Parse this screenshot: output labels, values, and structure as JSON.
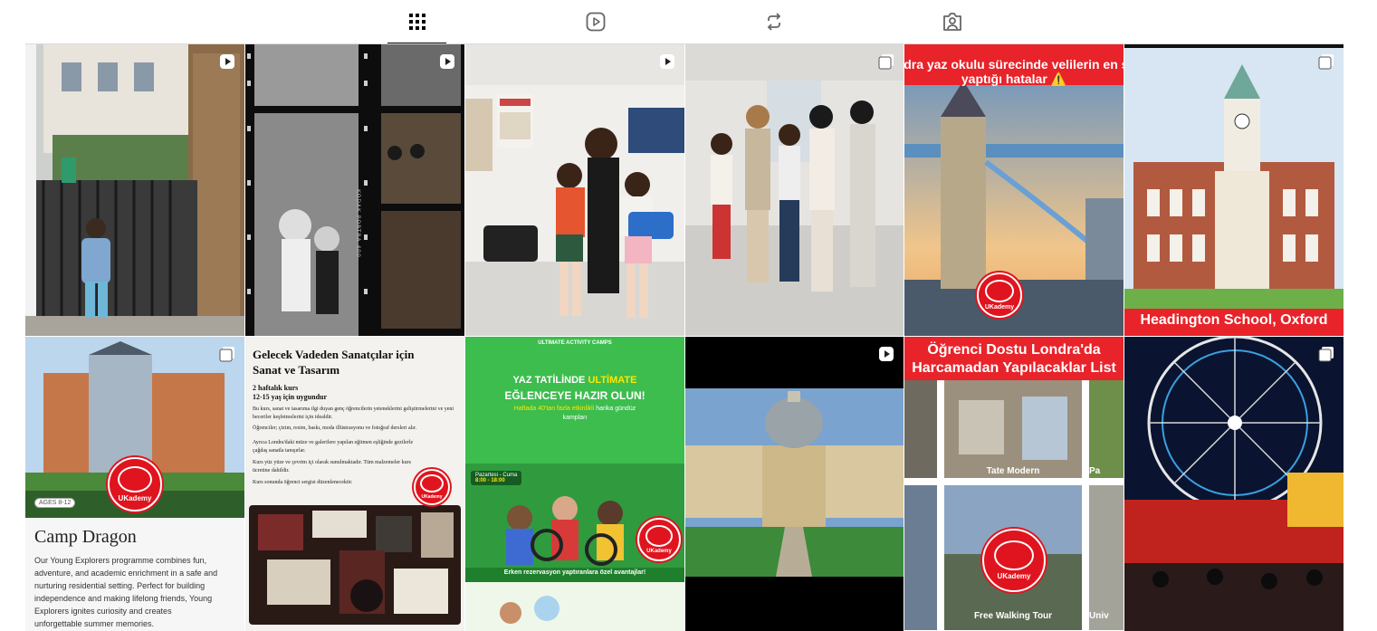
{
  "tabs": [
    {
      "id": "posts",
      "icon": "grid-icon",
      "active": true
    },
    {
      "id": "reels",
      "icon": "reels-icon",
      "active": false
    },
    {
      "id": "reposts",
      "icon": "repost-icon",
      "active": false
    },
    {
      "id": "tagged",
      "icon": "tagged-icon",
      "active": false
    }
  ],
  "posts": [
    {
      "id": "post-1",
      "badge": "reel-icon",
      "description_text": ""
    },
    {
      "id": "post-2",
      "badge": "reel-icon",
      "film_label": "KODAK PORTRA 400"
    },
    {
      "id": "post-3",
      "badge": "reel-icon"
    },
    {
      "id": "post-4",
      "badge": "carousel-icon"
    },
    {
      "id": "post-5",
      "badge": "",
      "headline_line1": "ndra yaz okulu sürecinde velilerin en sı",
      "headline_line2": "yaptığı hatalar ⚠️",
      "logo_text": "UKademy"
    },
    {
      "id": "post-6",
      "badge": "carousel-icon",
      "caption": "Headington School, Oxford"
    },
    {
      "id": "post-7",
      "badge": "carousel-icon",
      "logo_text": "UKademy",
      "age_tag": "AGES 8-12",
      "title": "Camp Dragon",
      "body": "Our Young Explorers programme combines fun, adventure, and academic enrichment in a safe and nurturing residential setting. Perfect for building independence and making lifelong friends, Young Explorers ignites curiosity and creates unforgettable summer memories."
    },
    {
      "id": "post-8",
      "badge": "",
      "title_line1": "Gelecek Vadeden Sanatçılar için",
      "title_line2": "Sanat ve Tasarım",
      "sub1": "2 haftalık kurs",
      "sub2": "12-15 yaş için uygundur",
      "p1": "Bu kurs, sanat ve tasarıma ilgi duyan genç öğrencilerin yeteneklerini geliştirmelerini ve yeni beceriler keşfetmelerini için idealdir.",
      "p2": "Öğrenciler; çizim, resim, baskı, moda illüstrasyonu ve fotoğraf dersleri alır.",
      "p3": "Ayrıca Londra'daki müze ve galerilere yapılan eğitmen eşliğinde gezilerle çağdaş sanatla tanışırlar.",
      "p4": "Kurs yüz yüze ve çevrim içi olarak sunulmaktadır. Tüm malzemeler kurs ücretine dahildir.",
      "p5": "Kurs sonunda öğrenci sergisi düzenlenecektir.",
      "logo_text": "UKademy"
    },
    {
      "id": "post-9",
      "badge": "",
      "brand": "ULTIMATE ACTIVITY CAMPS",
      "headline1a": "YAZ TATİLİNDE ",
      "headline1b": "ULTİMATE",
      "headline2": "EĞLENCEYE HAZIR OLUN!",
      "sub_a": "Haftada 40'tan fazla etkinlikli ",
      "sub_b": "harika gündüz",
      "sub_c": "kampları",
      "schedule1": "Pazartesi - Cuma",
      "schedule2": "8:00 - 18:00",
      "footer": "Erken rezervasyon yaptıranlara özel avantajlar!",
      "logo_text": "UKademy"
    },
    {
      "id": "post-10",
      "badge": "reel-icon"
    },
    {
      "id": "post-11",
      "badge": "",
      "title_line1": "Öğrenci Dostu Londra'da",
      "title_line2": "Harcamadan Yapılacaklar List",
      "label1": "Tate Modern",
      "label2": "Free Walking Tour",
      "label3": "Pa",
      "label4": "Univ",
      "logo_text": "UKademy"
    },
    {
      "id": "post-12",
      "badge": "carousel-icon"
    }
  ]
}
